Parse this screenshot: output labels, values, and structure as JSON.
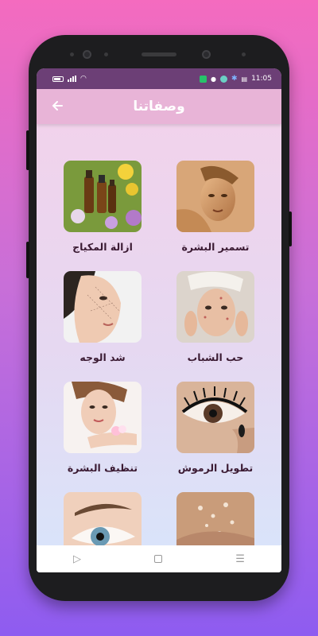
{
  "status_bar": {
    "time": "11:05",
    "icons": [
      "battery-icon",
      "signal-icon",
      "wifi-icon",
      "message-icon",
      "location-icon",
      "app-icon",
      "settings-icon",
      "notification-icon"
    ]
  },
  "app_bar": {
    "title": "وصفاتنا",
    "back_icon": "back-arrow-icon"
  },
  "recipes": [
    {
      "label": "تسمير البشرة",
      "image": "tanned-skin-photo"
    },
    {
      "label": "ازالة المكياج",
      "image": "essential-oils-photo"
    },
    {
      "label": "حب الشباب",
      "image": "acne-face-photo"
    },
    {
      "label": "شد الوجه",
      "image": "face-lift-photo"
    },
    {
      "label": "تطويل الرموش",
      "image": "eyelashes-photo"
    },
    {
      "label": "تنظيف البشرة",
      "image": "skin-cleansing-photo"
    },
    {
      "label": "",
      "image": "eyebrows-photo"
    },
    {
      "label": "",
      "image": "scrub-photo"
    }
  ],
  "nav_bar": {
    "back": "▷",
    "recents": "☰"
  },
  "colors": {
    "status_bar": "#6c3f76",
    "app_bar": "#e8b4d7",
    "label_text": "#3b1b33"
  }
}
